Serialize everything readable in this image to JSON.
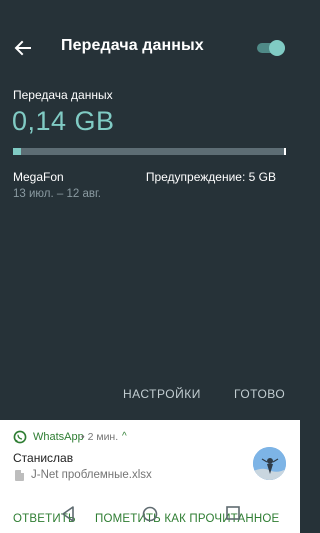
{
  "header": {
    "title": "Передача данных"
  },
  "usage": {
    "label": "Передача данных",
    "value": "0,14 GB",
    "fill_percent": 2.8,
    "carrier": "MegaFon",
    "warning": "Предупреждение: 5 GB",
    "period": "13 июл. – 12 авг."
  },
  "actions": {
    "settings": "НАСТРОЙКИ",
    "done": "ГОТОВО"
  },
  "notification": {
    "app": "WhatsApp",
    "meta": "• 2 мин.",
    "chevron": "^",
    "sender": "Станислав",
    "file": "J-Net проблемные.xlsx",
    "reply": "ОТВЕТИТЬ",
    "mark_read": "ПОМЕТИТЬ КАК ПРОЧИТАННОЕ"
  },
  "colors": {
    "background": "#263238",
    "accent": "#80cbc4",
    "whatsapp_green": "#2e7d32"
  },
  "icons": {
    "back": "back-arrow-icon",
    "toggle": "toggle-switch",
    "whatsapp": "whatsapp-icon",
    "file": "file-icon",
    "avatar": "avatar",
    "nav_back": "nav-back-icon",
    "nav_home": "nav-home-icon",
    "nav_recent": "nav-recents-icon"
  }
}
